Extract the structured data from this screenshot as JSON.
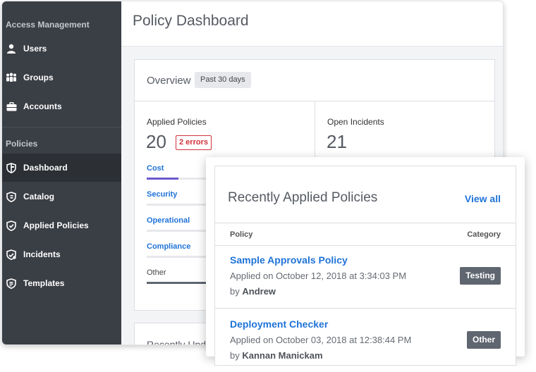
{
  "sidebar": {
    "section1": "Access Management",
    "section2": "Policies",
    "items": [
      {
        "label": "Users",
        "icon": "user-icon"
      },
      {
        "label": "Groups",
        "icon": "groups-icon"
      },
      {
        "label": "Accounts",
        "icon": "briefcase-icon"
      },
      {
        "label": "Dashboard",
        "icon": "shield-dashboard-icon",
        "active": true
      },
      {
        "label": "Catalog",
        "icon": "shield-catalog-icon"
      },
      {
        "label": "Applied Policies",
        "icon": "shield-check-icon"
      },
      {
        "label": "Incidents",
        "icon": "shield-alert-icon"
      },
      {
        "label": "Templates",
        "icon": "shield-template-icon"
      }
    ]
  },
  "header": {
    "title": "Policy Dashboard"
  },
  "overview": {
    "title": "Overview",
    "range": "Past 30 days",
    "applied": {
      "label": "Applied Policies",
      "value": "20",
      "errors": "2 errors"
    },
    "incidents": {
      "label": "Open Incidents",
      "value": "21"
    },
    "categories": [
      {
        "label": "Cost",
        "fraction": 0.2,
        "color": "#6a5acd"
      },
      {
        "label": "Security",
        "fraction": 0,
        "color": "#1f73d8"
      },
      {
        "label": "Operational",
        "fraction": 0,
        "color": "#1f73d8"
      },
      {
        "label": "Compliance",
        "fraction": 0,
        "color": "#1f73d8"
      },
      {
        "label": "Other",
        "fraction": 0.8,
        "color": "#5f6670"
      }
    ]
  },
  "recently_updated": {
    "title": "Recently Upd"
  },
  "recent_policies": {
    "title": "Recently Applied Policies",
    "view_all": "View all",
    "col_policy": "Policy",
    "col_category": "Category",
    "rows": [
      {
        "name": "Sample Approvals Policy",
        "date": "Applied on October 12, 2018 at 3:34:03 PM",
        "by_prefix": "by",
        "by": "Andrew",
        "category": "Testing"
      },
      {
        "name": "Deployment Checker",
        "date": "Applied on October 03, 2018 at 12:38:44 PM",
        "by_prefix": "by",
        "by": "Kannan Manickam",
        "category": "Other"
      }
    ]
  },
  "colors": {
    "sidebar": "#3a3e45",
    "link": "#1f73d8",
    "error": "#d0323a"
  }
}
